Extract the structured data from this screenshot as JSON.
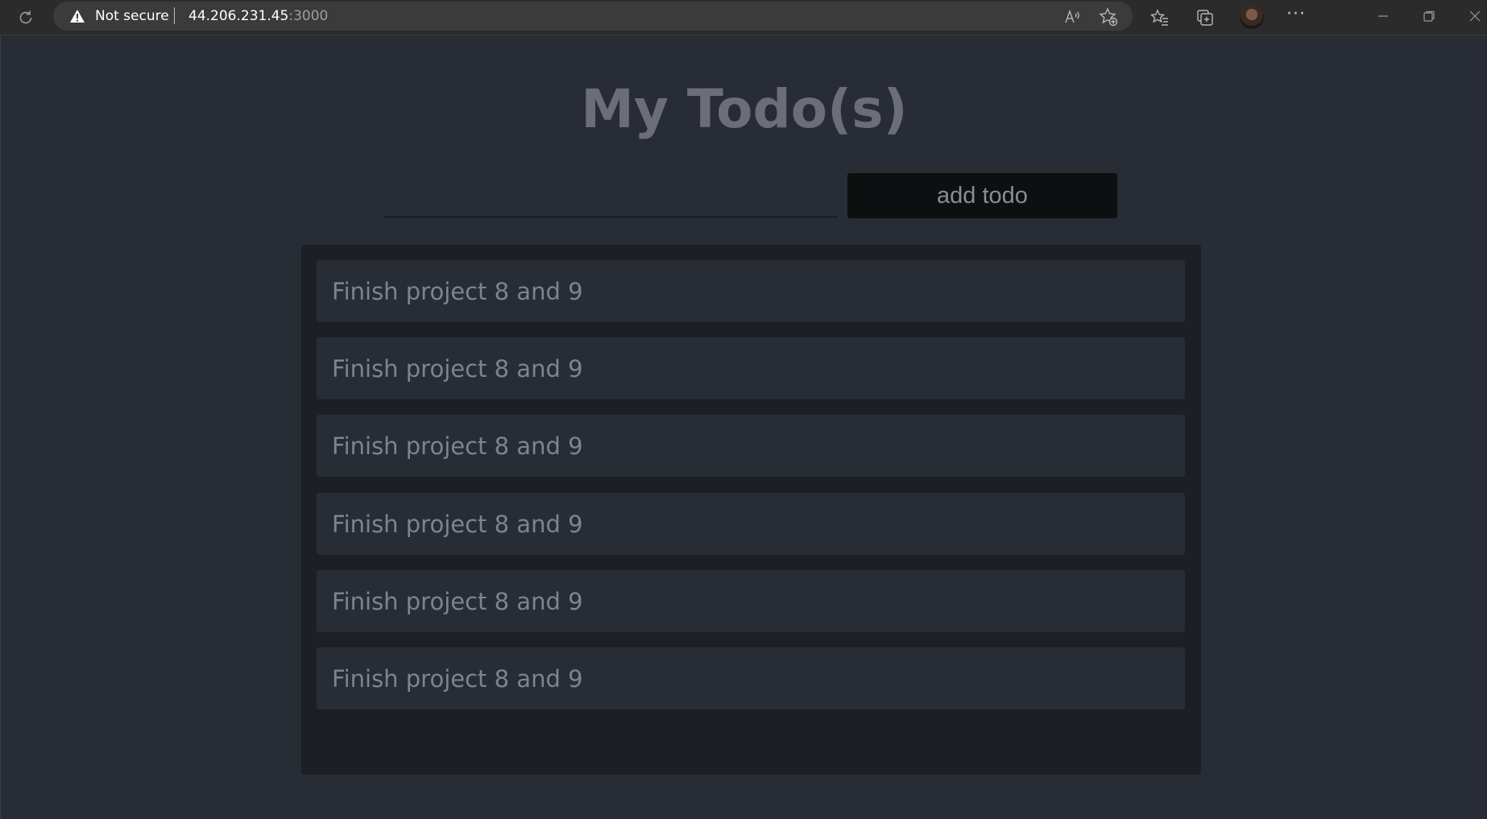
{
  "browser": {
    "security_label": "Not secure",
    "url_host": "44.206.231.45",
    "url_port": ":3000",
    "more_label": "···"
  },
  "page": {
    "title": "My Todo(s)",
    "input": {
      "value": "",
      "placeholder": ""
    },
    "add_button_label": "add todo",
    "todos": [
      "Finish project 8 and 9",
      "Finish project 8 and 9",
      "Finish project 8 and 9",
      "Finish project 8 and 9",
      "Finish project 8 and 9",
      "Finish project 8 and 9"
    ]
  },
  "colors": {
    "background": "#282c34",
    "list_background": "#1c1f24",
    "button_background": "#0e0f10",
    "title_color": "#6b6e76",
    "item_text": "#7f838b"
  }
}
